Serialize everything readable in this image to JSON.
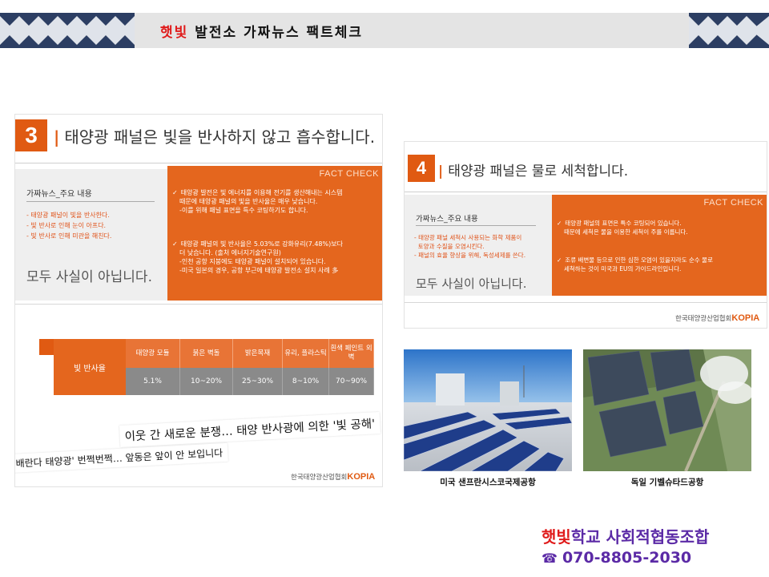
{
  "header": {
    "title_highlight": "햇빛",
    "title_rest": " 발전소 가짜뉴스 팩트체크"
  },
  "slide3": {
    "number": "3",
    "heading": "태양광 패널은 빛을 반사하지 않고 흡수합니다.",
    "fake_label": "가짜뉴스_주요 내용",
    "fake_items": [
      "- 태양광 패널이 빛을 반사한다.",
      "- 빛 반사로 인해 눈이 아프다.",
      "- 빛 반사로 인해 미관을 해친다."
    ],
    "verdict": "모두 사실이 아닙니다.",
    "fact_title": "FACT CHECK",
    "fact1_main": "태양광 발전은 빛 에너지를 이용해 전기를 생산해내는 시스템",
    "fact1_l2": "때문에 태양광 패널의 빛을 반사율은 매우 낮습니다.",
    "fact1_l3": "-이를 위해 패널 표면을 특수 코팅하기도 합니다.",
    "fact2_main": "태양광 패널의 빛 반사율은 5.03%로 강화유리(7.48%)보다",
    "fact2_l2": "더 낮습니다. (출처 에너지기술연구원)",
    "fact2_l3": "-인천 공항 지붕에도 태양광 패널이 설치되어 있습니다.",
    "fact2_l4": "-미국 일본의 경우, 공항 부근에 태양광 발전소 설치 사례 多",
    "reflectance_label": "빛 반사율",
    "reflectance_headers": [
      "태양광 모듈",
      "붉은 벽돌",
      "밝은목재",
      "유리, 플라스틱",
      "흰색 페인트 외벽"
    ],
    "reflectance_values": [
      "5.1%",
      "10~20%",
      "25~30%",
      "8~10%",
      "70~90%"
    ],
    "clip1": "이웃 간 새로운 분쟁… 태양 반사광에 의한 '빛 공해'",
    "clip2": "배란다 태양광' 번쩍번쩍… 앞동은 앞이 안 보입니다",
    "logo_org": "한국태양광산업협회",
    "logo_brand": "KOPIA"
  },
  "slide4": {
    "number": "4",
    "heading": "태양광 패널은 물로 세척합니다.",
    "fake_label": "가짜뉴스_주요 내용",
    "fake_items": [
      "- 태양광 패널 세척시 사용되는 화학 제품이",
      "  토양과 수질을 오염시킨다.",
      "- 패널의 효율 향상을 위해, 독성세제를 쓴다."
    ],
    "verdict": "모두 사실이 아닙니다.",
    "fact_title": "FACT CHECK",
    "fact1_main": "태양광 패널의 표면은 특수 코팅되어 있습니다.",
    "fact1_l2": "때문에 세척은 물을 이용한 세척이 주를 이룹니다.",
    "fact2_main": "조류 배변물 등으로 인한 심한 오염이 있을지라도 순수 물로",
    "fact2_l2": "세척하는 것이 미국과 EU의 가이드라인입니다.",
    "logo_org": "한국태양광산업협회",
    "logo_brand": "KOPIA"
  },
  "photos": {
    "caption_left": "미국 샌프란시스코국제공항",
    "caption_right": "독일 기벨슈타드공항"
  },
  "footer": {
    "org_highlight": "햇빛",
    "org_rest": "학교 사회적협동조합",
    "phone_icon": "☎",
    "phone": "070-8805-2030"
  },
  "colors": {
    "accent_orange": "#e05a12",
    "title_red": "#e01b1b",
    "footer_purple": "#5b2aa6"
  }
}
